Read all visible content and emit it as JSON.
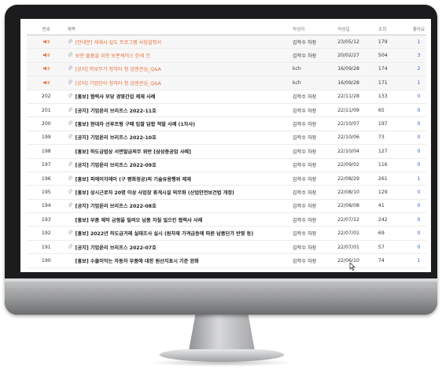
{
  "table": {
    "headers": {
      "num": "번호",
      "title": "제목",
      "author": "작성자",
      "date": "작성일",
      "views": "조회",
      "likes": "좋아요"
    },
    "notices": [
      {
        "title": "[안내문] 게재시 쉽도 프로그램 사업설명서",
        "author": "김학수 차장",
        "date": "23/05/12",
        "views": "179",
        "likes": "1",
        "clip": true
      },
      {
        "title": "보안 물품을 위한 보존케이스 한세 건",
        "author": "김학수 차장",
        "date": "20/02/27",
        "views": "504",
        "likes": "3",
        "clip": true
      },
      {
        "title": "[공지] 학보무가 청하아 청 검엔관심_Q&A",
        "author": "kch",
        "date": "16/09/28",
        "views": "174",
        "likes": "2",
        "clip": true
      },
      {
        "title": "[공지] 기업인이 청하아 청 검엔관심_Q&A",
        "author": "kch",
        "date": "16/09/28",
        "views": "171",
        "likes": "1",
        "clip": true
      }
    ],
    "rows": [
      {
        "num": "202",
        "title": "[홍보] 협력사 부당 경영간섭 제재 사례",
        "author": "김학수 차장",
        "date": "22/11/28",
        "views": "133",
        "likes": "0",
        "clip": true
      },
      {
        "num": "201",
        "title": "[공지] 기업윤리 브리프스 2022-11호",
        "author": "김학수 차장",
        "date": "22/11/09",
        "views": "65",
        "likes": "0",
        "clip": true
      },
      {
        "num": "200",
        "title": "[홍보] 현대차 선루프형 구매 입찰 담합 적발 사례 (1차사)",
        "author": "김학수 차장",
        "date": "22/10/07",
        "views": "197",
        "likes": "0",
        "clip": true
      },
      {
        "num": "199",
        "title": "[공지] 기업윤리 브리프스 2022-10호",
        "author": "김학수 차장",
        "date": "22/10/06",
        "views": "73",
        "likes": "0",
        "clip": true
      },
      {
        "num": "198",
        "title": "[홍보] 하도급법상 서면발급의무 위반 [삼성중공업 사례]",
        "author": "김학수 차장",
        "date": "22/10/04",
        "views": "127",
        "likes": "0",
        "clip": false
      },
      {
        "num": "197",
        "title": "[공지] 기업윤리 브리프스 2022-09호",
        "author": "김학수 차장",
        "date": "22/09/02",
        "views": "116",
        "likes": "0",
        "clip": true
      },
      {
        "num": "196",
        "title": "[홍보] 피에이치에이 (구 평화정공)의 기술유용행위 제재",
        "author": "김학수 차장",
        "date": "22/08/29",
        "views": "261",
        "likes": "1",
        "clip": true
      },
      {
        "num": "195",
        "title": "[홍보] 상시근로자 20명 이상 사업장 휴게시설 의무화 (산업안전보건법 개정)",
        "author": "김학수 차장",
        "date": "22/08/10",
        "views": "129",
        "likes": "0",
        "clip": true
      },
      {
        "num": "194",
        "title": "[공지] 기업윤리 브리프스 2022-08호",
        "author": "김학수 차장",
        "date": "22/08/08",
        "views": "41",
        "likes": "0",
        "clip": true
      },
      {
        "num": "193",
        "title": "[홍보] 부품 제작 금형을 빌려오 납품 차질 일으킨 협력사 사례",
        "author": "김학수 차장",
        "date": "22/07/12",
        "views": "242",
        "likes": "0",
        "clip": false
      },
      {
        "num": "192",
        "title": "[홍보] 2022년 하도급거래 실태조사 실시 (원자재 가격급등에 따른 납품단가 반영 등)",
        "author": "김학수 차장",
        "date": "22/07/01",
        "views": "69",
        "likes": "0",
        "clip": true
      },
      {
        "num": "191",
        "title": "[공지] 기업윤리 브리프스 2022-07호",
        "author": "김학수 차장",
        "date": "22/07/01",
        "views": "57",
        "likes": "0",
        "clip": true
      },
      {
        "num": "190",
        "title": "[홍보] 수출이익는 자동차 부품에 대한 원산지표시 기준 완화",
        "author": "김학수 차장",
        "date": "22/06/10",
        "views": "74",
        "likes": "1",
        "clip": false
      }
    ]
  },
  "colors": {
    "notice": "#e8703a",
    "likes": "#3a62c9",
    "bezel": "#1c1c1e"
  },
  "icons": {
    "notice": "speaker-icon",
    "attachment": "paperclip-icon",
    "cursor": "mouse-cursor-icon"
  }
}
